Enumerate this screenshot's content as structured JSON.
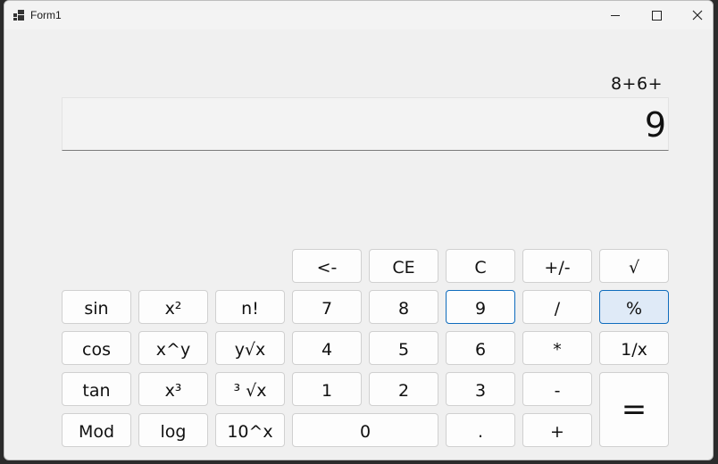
{
  "window": {
    "title": "Form1",
    "icon": "app-window-icon",
    "controls": {
      "minimize": "minimize-icon",
      "maximize": "maximize-icon",
      "close": "close-icon"
    }
  },
  "display": {
    "expression": "8+6+",
    "value": "9"
  },
  "keys": {
    "backspace": "<-",
    "ce": "CE",
    "c": "C",
    "negate": "+/-",
    "sqrt": "√",
    "sin": "sin",
    "square": "x²",
    "factorial": "n!",
    "seven": "7",
    "eight": "8",
    "nine": "9",
    "divide": "/",
    "percent": "%",
    "cos": "cos",
    "power": "x^y",
    "yroot": "y√x",
    "four": "4",
    "five": "5",
    "six": "6",
    "multiply": "*",
    "reciprocal": "1/x",
    "tan": "tan",
    "cube": "x³",
    "cuberoot": "³ √x",
    "one": "1",
    "two": "2",
    "three": "3",
    "subtract": "-",
    "equals": "=",
    "mod": "Mod",
    "log": "log",
    "tenpow": "10^x",
    "zero": "0",
    "decimal": ".",
    "add": "+"
  },
  "state": {
    "focused_key": "9",
    "hovered_key": "%"
  },
  "colors": {
    "accent": "#0f6cbd",
    "hover_bg": "#dfeaf7",
    "window_bg": "#f0f0f0"
  }
}
